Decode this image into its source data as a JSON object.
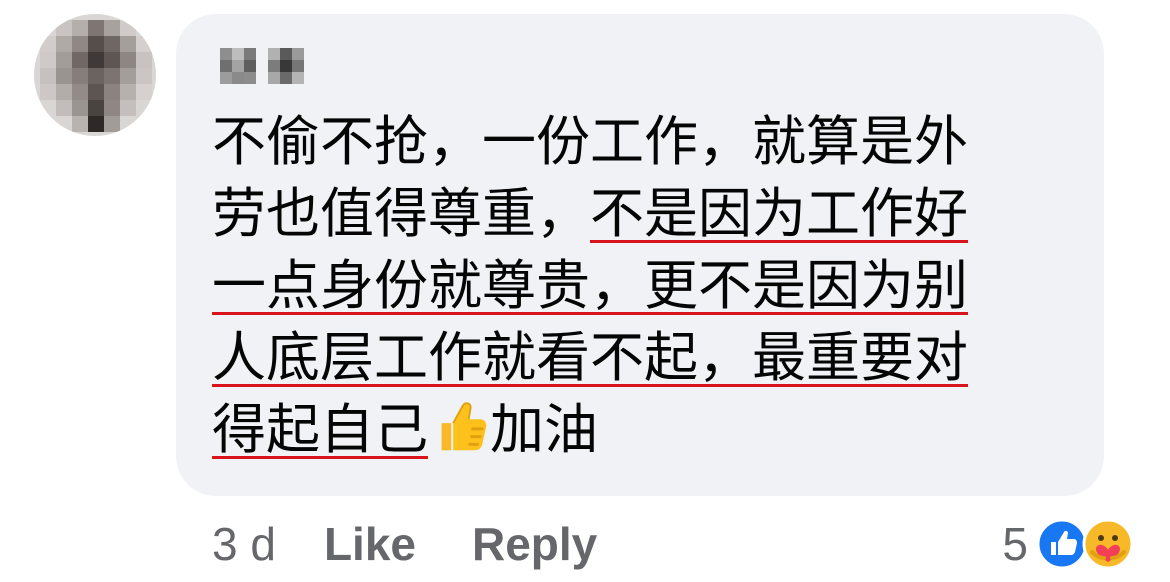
{
  "comment": {
    "author_name": "",
    "lines": [
      {
        "plain": "不偷不抢，一份工作，就算是外",
        "underlined": ""
      },
      {
        "plain": "劳也值得尊重，",
        "underlined": "不是因为工作好"
      },
      {
        "plain": "",
        "underlined": "一点身份就尊贵，更不是因为别"
      },
      {
        "plain": "",
        "underlined": "人底层工作就看不起，最重要对"
      },
      {
        "plain": "",
        "underlined": "得起自己",
        "emoji": "thumbs-up-icon",
        "after": "加油"
      }
    ]
  },
  "actions": {
    "time": "3 d",
    "like_label": "Like",
    "reply_label": "Reply"
  },
  "reactions": {
    "count": "5",
    "icons": [
      "like-reaction-icon",
      "care-reaction-icon"
    ]
  },
  "colors": {
    "bubble_bg": "#f0f2f5",
    "text": "#050505",
    "meta": "#65676b",
    "underline": "#d9131d",
    "like_blue": "#1877f2",
    "care_yellow": "#f7b928"
  }
}
